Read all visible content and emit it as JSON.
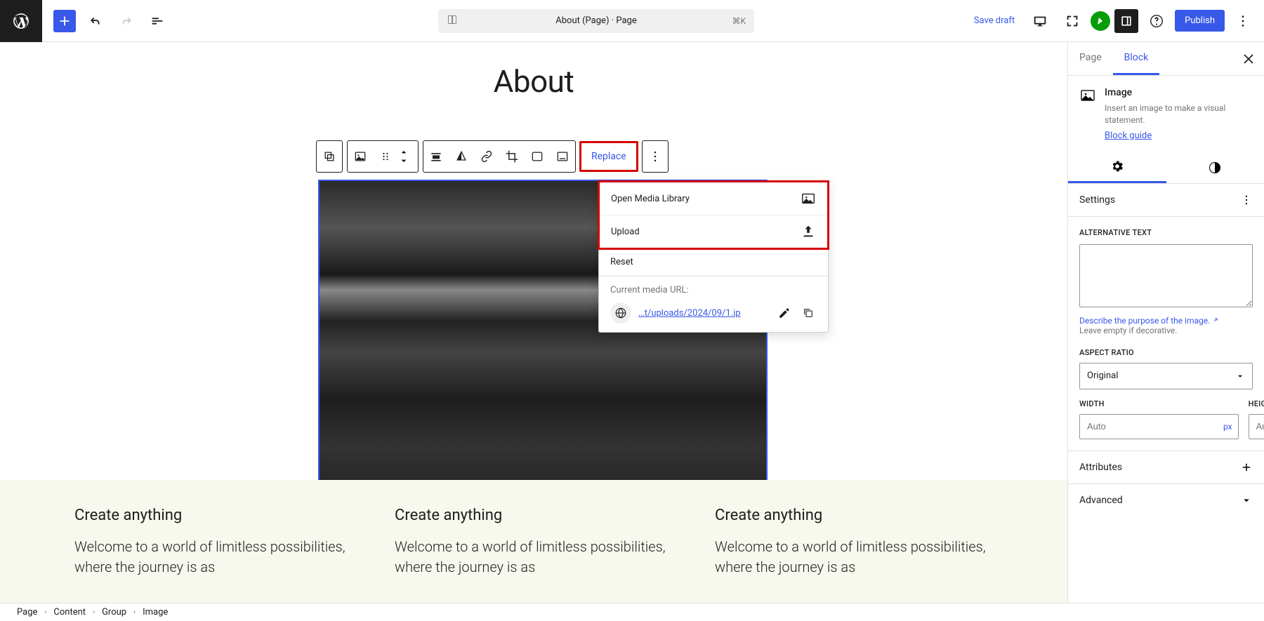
{
  "toolbar": {
    "document_title": "About (Page) · Page",
    "shortcut": "⌘K",
    "save_draft": "Save draft",
    "publish": "Publish"
  },
  "page_title": "About",
  "block_toolbar": {
    "replace": "Replace"
  },
  "dropdown": {
    "open_media_library": "Open Media Library",
    "upload": "Upload",
    "reset": "Reset",
    "current_url_label": "Current media URL:",
    "url_display": "…t/uploads/2024/09/1.jp"
  },
  "columns": [
    {
      "heading": "Create anything",
      "body": "Welcome to a world of limitless possibilities, where the journey is as"
    },
    {
      "heading": "Create anything",
      "body": "Welcome to a world of limitless possibilities, where the journey is as"
    },
    {
      "heading": "Create anything",
      "body": "Welcome to a world of limitless possibilities, where the journey is as"
    }
  ],
  "sidebar": {
    "tab_page": "Page",
    "tab_block": "Block",
    "block_name": "Image",
    "block_desc": "Insert an image to make a visual statement.",
    "block_guide": "Block guide",
    "settings_label": "Settings",
    "alt_text_label": "ALTERNATIVE TEXT",
    "alt_help_link": "Describe the purpose of the image.",
    "alt_help_suffix": "Leave empty if decorative.",
    "aspect_ratio_label": "ASPECT RATIO",
    "aspect_ratio_value": "Original",
    "width_label": "WIDTH",
    "height_label": "HEIGHT",
    "dim_placeholder": "Auto",
    "dim_unit": "px",
    "attributes": "Attributes",
    "advanced": "Advanced"
  },
  "breadcrumb": [
    "Page",
    "Content",
    "Group",
    "Image"
  ]
}
